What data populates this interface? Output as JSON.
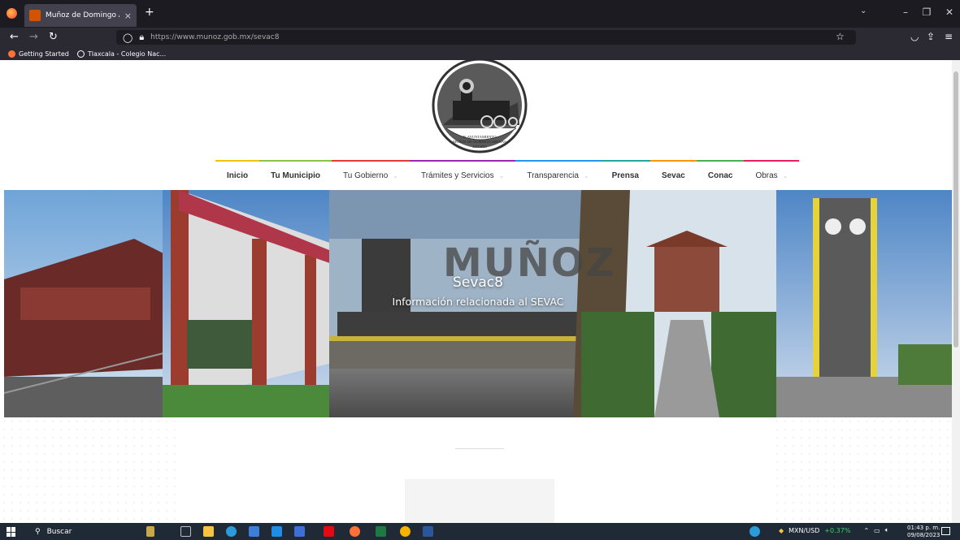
{
  "browser": {
    "tab_title": "Muñoz de Domingo Arenas",
    "tab_close": "×",
    "new_tab": "+",
    "url": "https://www.munoz.gob.mx/sevac8",
    "bookmarks": [
      {
        "label": "Getting Started"
      },
      {
        "label": "Tlaxcala - Colegio Nac..."
      }
    ]
  },
  "site": {
    "logo_text_1": "H. AYUNTAMIENTO",
    "logo_text_2": "MUÑOZ DE DOMINGO ARENAS",
    "logo_text_3": "2021-2024",
    "menu": [
      {
        "label": "Inicio",
        "color": "#f4c20d",
        "dropdown": false
      },
      {
        "label": "Tu Municipio",
        "color": "#8bc34a",
        "dropdown": false
      },
      {
        "label": "Tu Gobierno",
        "color": "#e53935",
        "dropdown": true
      },
      {
        "label": "Trámites y Servicios",
        "color": "#9c27b0",
        "dropdown": true
      },
      {
        "label": "Transparencia",
        "color": "#2196f3",
        "dropdown": true
      },
      {
        "label": "Prensa",
        "color": "#26a69a",
        "dropdown": false
      },
      {
        "label": "Sevac",
        "color": "#ff9800",
        "dropdown": false
      },
      {
        "label": "Conac",
        "color": "#4caf50",
        "dropdown": false
      },
      {
        "label": "Obras",
        "color": "#e91e63",
        "dropdown": true
      }
    ],
    "hero": {
      "watermark": "MUÑOZ",
      "title": "Sevac8",
      "subtitle": "Información relacionada al SEVAC"
    }
  },
  "taskbar": {
    "search_placeholder": "Buscar",
    "currency": "MXN/USD",
    "currency_change": "+0.37%",
    "time": "01:43 p. m.",
    "date": "09/08/2023"
  }
}
